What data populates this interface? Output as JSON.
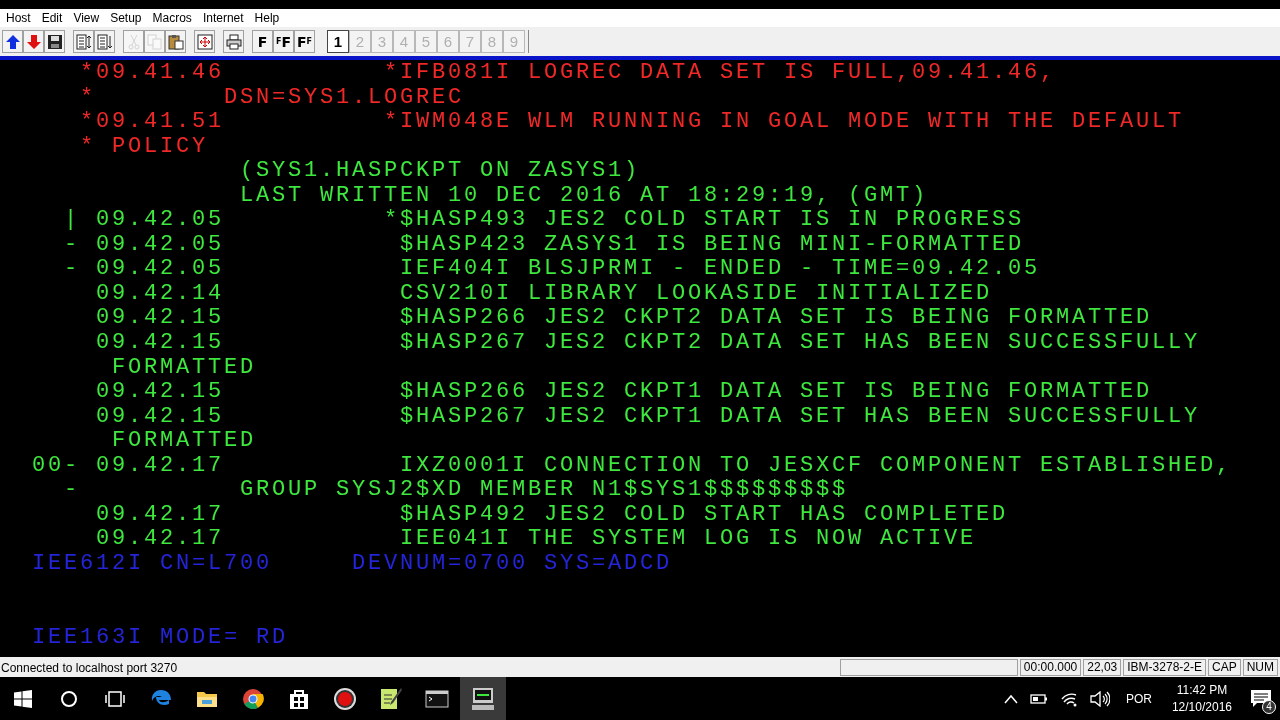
{
  "menu": [
    "Host",
    "Edit",
    "View",
    "Setup",
    "Macros",
    "Internet",
    "Help"
  ],
  "toolbar": [
    {
      "kind": "up",
      "disabled": false
    },
    {
      "kind": "down",
      "disabled": false
    },
    {
      "kind": "save",
      "disabled": false
    },
    {
      "kind": "sep"
    },
    {
      "kind": "doc-updown",
      "disabled": false
    },
    {
      "kind": "doc-down",
      "disabled": false
    },
    {
      "kind": "sep"
    },
    {
      "kind": "cut",
      "disabled": true
    },
    {
      "kind": "copy",
      "disabled": true
    },
    {
      "kind": "paste",
      "disabled": false
    },
    {
      "kind": "sep"
    },
    {
      "kind": "fit",
      "disabled": false
    },
    {
      "kind": "sep"
    },
    {
      "kind": "print",
      "disabled": false
    },
    {
      "kind": "sep"
    },
    {
      "kind": "font",
      "label": "F"
    },
    {
      "kind": "font",
      "label": "$^{F}$F"
    },
    {
      "kind": "font",
      "label": "F$^{F}$"
    },
    {
      "kind": "sep"
    }
  ],
  "sessions": [
    {
      "label": "1",
      "selected": true
    },
    {
      "label": "2",
      "selected": false
    },
    {
      "label": "3",
      "selected": false
    },
    {
      "label": "4",
      "selected": false
    },
    {
      "label": "5",
      "selected": false
    },
    {
      "label": "6",
      "selected": false
    },
    {
      "label": "7",
      "selected": false
    },
    {
      "label": "8",
      "selected": false
    },
    {
      "label": "9",
      "selected": false
    }
  ],
  "screen": {
    "lines": [
      {
        "kind": "message",
        "color": "#f02828",
        "time_mark": "*",
        "time": "09.41.46",
        "text_mark": "*",
        "text": "IFB081I LOGREC DATA SET IS FULL,09.41.46,"
      },
      {
        "kind": "param",
        "color": "#f02828",
        "time_mark": "*",
        "text": "DSN=SYS1.LOGREC"
      },
      {
        "kind": "message",
        "color": "#f02828",
        "time_mark": "*",
        "time": "09.41.51",
        "text_mark": "*",
        "text": "IWM048E WLM RUNNING IN GOAL MODE WITH THE DEFAULT"
      },
      {
        "kind": "wrap",
        "color": "#f02828",
        "time_mark": "*",
        "text": "POLICY"
      },
      {
        "kind": "detail",
        "color": "#3ee83e",
        "text": "(SYS1.HASPCKPT ON ZASYS1)"
      },
      {
        "kind": "detail",
        "color": "#3ee83e",
        "text": "LAST WRITTEN 10 DEC 2016 AT 18:29:19, (GMT)"
      },
      {
        "kind": "message",
        "color": "#3ee83e",
        "flag": "|",
        "time": "09.42.05",
        "text_mark": "*",
        "text": "$HASP493 JES2 COLD START IS IN PROGRESS"
      },
      {
        "kind": "message",
        "color": "#3ee83e",
        "flag": "-",
        "time": "09.42.05",
        "text": "$HASP423 ZASYS1 IS BEING MINI-FORMATTED"
      },
      {
        "kind": "message",
        "color": "#3ee83e",
        "flag": "-",
        "time": "09.42.05",
        "text": "IEF404I BLSJPRMI - ENDED - TIME=09.42.05"
      },
      {
        "kind": "message",
        "color": "#3ee83e",
        "time": "09.42.14",
        "text": "CSV210I LIBRARY LOOKASIDE INITIALIZED"
      },
      {
        "kind": "message",
        "color": "#3ee83e",
        "time": "09.42.15",
        "text": "$HASP266 JES2 CKPT2 DATA SET IS BEING FORMATTED"
      },
      {
        "kind": "message",
        "color": "#3ee83e",
        "time": "09.42.15",
        "text": "$HASP267 JES2 CKPT2 DATA SET HAS BEEN SUCCESSFULLY"
      },
      {
        "kind": "wrap",
        "color": "#3ee83e",
        "text": "FORMATTED"
      },
      {
        "kind": "message",
        "color": "#3ee83e",
        "time": "09.42.15",
        "text": "$HASP266 JES2 CKPT1 DATA SET IS BEING FORMATTED"
      },
      {
        "kind": "message",
        "color": "#3ee83e",
        "time": "09.42.15",
        "text": "$HASP267 JES2 CKPT1 DATA SET HAS BEEN SUCCESSFULLY"
      },
      {
        "kind": "wrap",
        "color": "#3ee83e",
        "text": "FORMATTED"
      },
      {
        "kind": "message",
        "color": "#3ee83e",
        "flag": "00-",
        "time": "09.42.17",
        "text": "IXZ0001I CONNECTION TO JESXCF COMPONENT ESTABLISHED,"
      },
      {
        "kind": "detail",
        "color": "#3ee83e",
        "flag": "-",
        "text": "GROUP SYSJ2$XD MEMBER N1$SYS1$$$$$$$$$"
      },
      {
        "kind": "message",
        "color": "#3ee83e",
        "time": "09.42.17",
        "text": "$HASP492 JES2 COLD START HAS COMPLETED"
      },
      {
        "kind": "message",
        "color": "#3ee83e",
        "time": "09.42.17",
        "text": "IEE041I THE SYSTEM LOG IS NOW ACTIVE"
      },
      {
        "kind": "status",
        "color": "#2424d8",
        "text": "IEE612I CN=L700",
        "field": "DEVNUM=0700 SYS=ADCD"
      },
      {
        "kind": "blank"
      },
      {
        "kind": "blank"
      },
      {
        "kind": "status",
        "color": "#2424d8",
        "text": "IEE163I MODE= RD"
      }
    ]
  },
  "status_bar": {
    "message": "Connected to localhost port 3270",
    "cells": [
      "00:00.000",
      "22,03",
      "IBM-3278-2-E",
      "CAP",
      "NUM"
    ]
  },
  "taskbar": {
    "items": [
      {
        "kind": "start",
        "selected": false
      },
      {
        "kind": "search",
        "selected": false
      },
      {
        "kind": "taskview",
        "selected": false
      },
      {
        "kind": "edge",
        "selected": false
      },
      {
        "kind": "folder",
        "selected": false
      },
      {
        "kind": "chrome",
        "selected": false
      },
      {
        "kind": "store",
        "selected": false
      },
      {
        "kind": "record",
        "selected": false
      },
      {
        "kind": "notepad",
        "selected": false
      },
      {
        "kind": "console",
        "selected": false
      },
      {
        "kind": "terminal",
        "selected": true
      }
    ],
    "language": "POR",
    "time": "11:42 PM",
    "date": "12/10/2016",
    "notifications": "4"
  }
}
